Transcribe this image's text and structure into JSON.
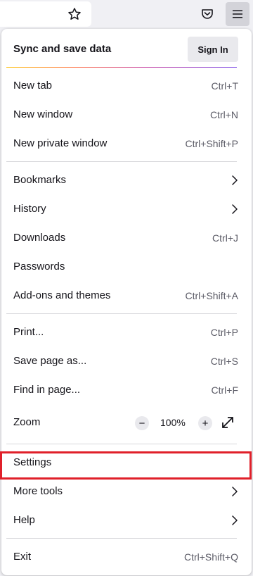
{
  "toolbar": {
    "icons": [
      "star-icon",
      "pocket-icon",
      "hamburger-menu-icon"
    ]
  },
  "sync": {
    "title": "Sync and save data",
    "signin_label": "Sign In"
  },
  "menu": {
    "group1": [
      {
        "label": "New tab",
        "shortcut": "Ctrl+T"
      },
      {
        "label": "New window",
        "shortcut": "Ctrl+N"
      },
      {
        "label": "New private window",
        "shortcut": "Ctrl+Shift+P"
      }
    ],
    "group2": [
      {
        "label": "Bookmarks",
        "submenu": true
      },
      {
        "label": "History",
        "submenu": true
      },
      {
        "label": "Downloads",
        "shortcut": "Ctrl+J"
      },
      {
        "label": "Passwords"
      },
      {
        "label": "Add-ons and themes",
        "shortcut": "Ctrl+Shift+A"
      }
    ],
    "group3": [
      {
        "label": "Print...",
        "shortcut": "Ctrl+P"
      },
      {
        "label": "Save page as...",
        "shortcut": "Ctrl+S"
      },
      {
        "label": "Find in page...",
        "shortcut": "Ctrl+F"
      }
    ],
    "zoom": {
      "label": "Zoom",
      "minus": "−",
      "value": "100%",
      "plus": "+"
    },
    "group4": [
      {
        "label": "Settings"
      },
      {
        "label": "More tools",
        "submenu": true,
        "highlighted": true
      },
      {
        "label": "Help",
        "submenu": true
      }
    ],
    "exit": {
      "label": "Exit",
      "shortcut": "Ctrl+Shift+Q"
    }
  },
  "colors": {
    "highlight_border": "#e0202a",
    "panel_bg": "#ffffff",
    "toolbar_bg": "#f0f0f4"
  }
}
